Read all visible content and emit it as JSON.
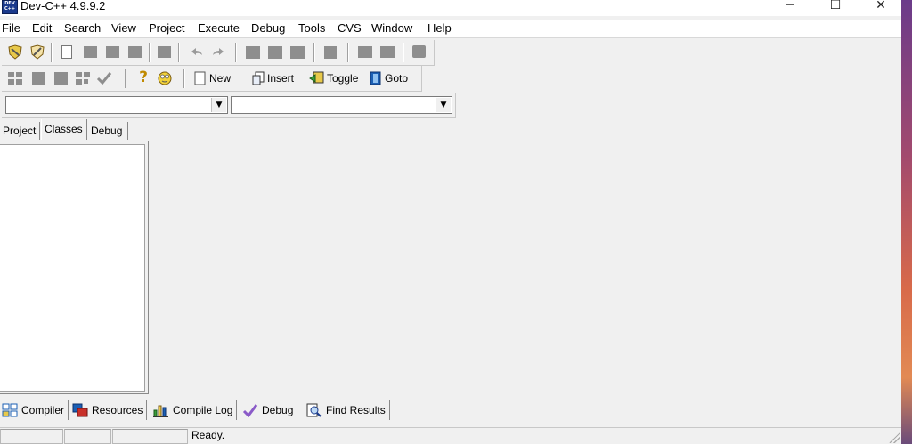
{
  "window": {
    "title": "Dev-C++ 4.9.9.2",
    "app_icon_text": "DEV C++",
    "controls": {
      "minimize": "─",
      "maximize": "☐",
      "close": "✕"
    }
  },
  "menubar": {
    "items": [
      "File",
      "Edit",
      "Search",
      "View",
      "Project",
      "Execute",
      "Debug",
      "Tools",
      "CVS",
      "Window",
      "Help"
    ]
  },
  "toolbar2": {
    "help_icon": "?",
    "new_label": "New",
    "insert_label": "Insert",
    "toggle_label": "Toggle",
    "goto_label": "Goto"
  },
  "left_tabs": [
    "Project",
    "Classes",
    "Debug"
  ],
  "bottom_tabs": [
    "Compiler",
    "Resources",
    "Compile Log",
    "Debug",
    "Find Results"
  ],
  "status": {
    "message": "Ready."
  },
  "colors": {
    "chrome": "#f0f0f0",
    "titlebar": "#ffffff",
    "icon_gray": "#8e8e8e",
    "accent_blue": "#1b3a8c",
    "accent_yellow": "#e8c94a",
    "accent_green": "#3a9b3a"
  }
}
